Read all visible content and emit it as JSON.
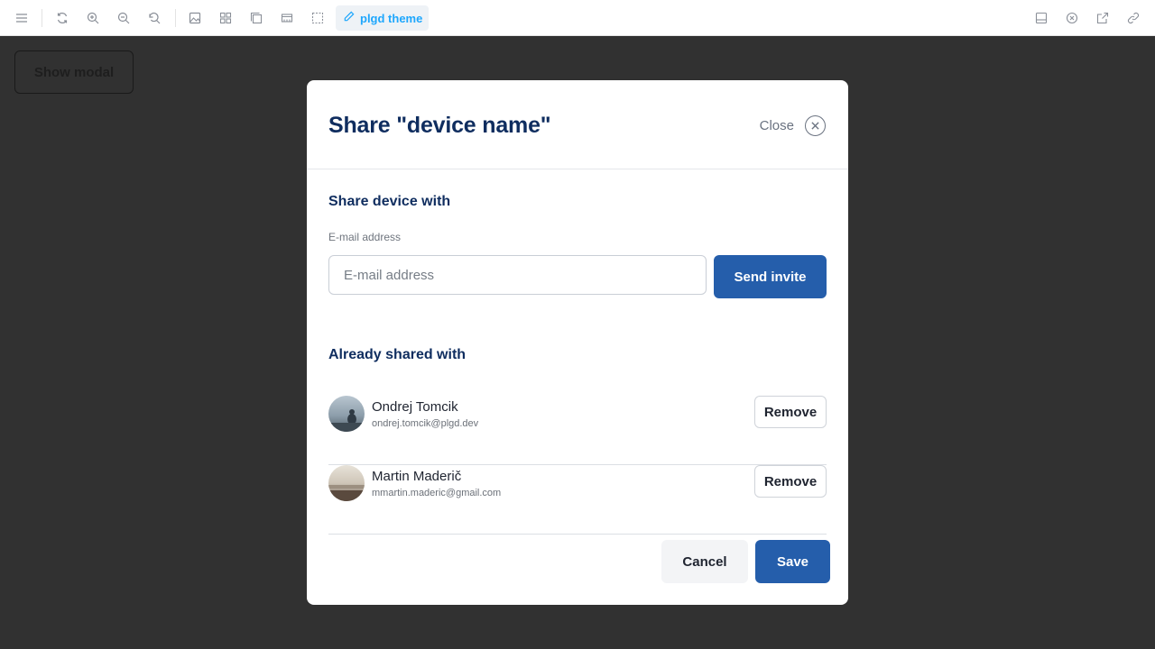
{
  "toolbar": {
    "theme_label": "plgd theme",
    "accent_color": "#1ea7fd",
    "icons_left": [
      "menu-icon",
      "reload-icon",
      "zoom-in-icon",
      "zoom-out-icon",
      "reset-zoom-icon",
      "background-icon",
      "grid-icon",
      "outline-icon",
      "viewport-icon",
      "measure-icon",
      "theme-brush-icon"
    ],
    "icons_right": [
      "panel-icon",
      "close-story-icon",
      "open-new-tab-icon",
      "copy-link-icon"
    ]
  },
  "canvas": {
    "show_modal_label": "Show modal",
    "background_color": "#313131"
  },
  "modal": {
    "title": "Share \"device name\"",
    "close_label": "Close",
    "share_section_title": "Share device with",
    "email_label": "E-mail address",
    "email_placeholder": "E-mail address",
    "email_value": "",
    "send_invite_label": "Send invite",
    "shared_section_title": "Already shared with",
    "users": [
      {
        "name": "Ondrej Tomcik",
        "email": "ondrej.tomcik@plgd.dev",
        "remove_label": "Remove"
      },
      {
        "name": "Martin Maderič",
        "email": "mmartin.maderic@gmail.com",
        "remove_label": "Remove"
      }
    ],
    "cancel_label": "Cancel",
    "save_label": "Save",
    "primary_color": "#255eab",
    "heading_color": "#0f2d5f"
  }
}
